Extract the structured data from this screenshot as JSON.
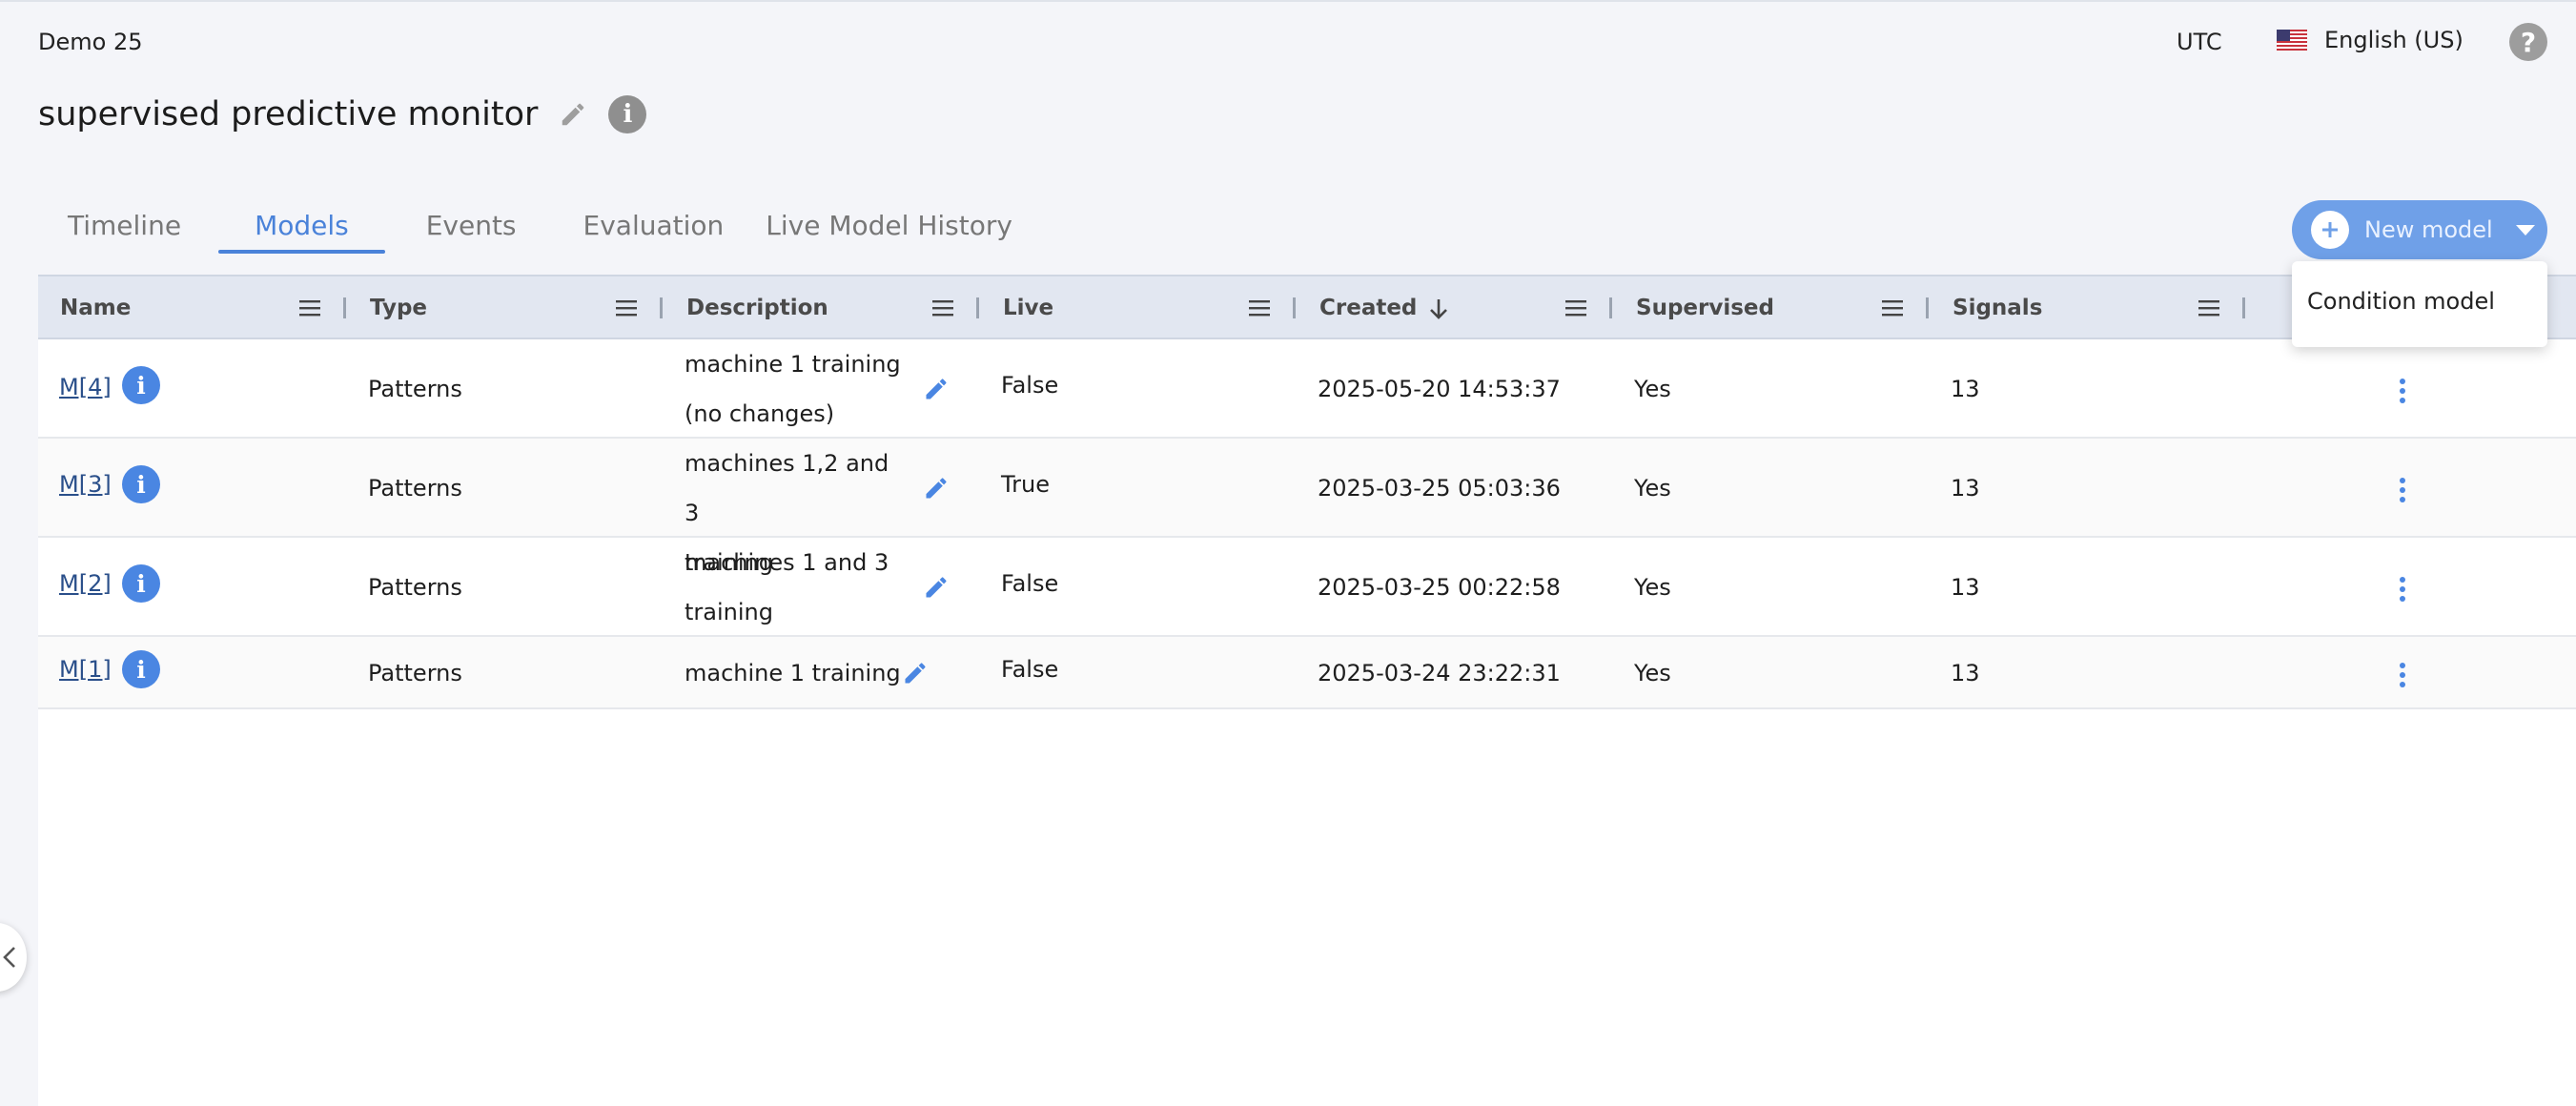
{
  "header": {
    "org": "Demo 25",
    "timezone": "UTC",
    "language": "English (US)",
    "help_icon": "question-circle-icon"
  },
  "page": {
    "title": "supervised predictive monitor"
  },
  "tabs": [
    {
      "label": "Timeline",
      "active": false
    },
    {
      "label": "Models",
      "active": true
    },
    {
      "label": "Events",
      "active": false
    },
    {
      "label": "Evaluation",
      "active": false
    },
    {
      "label": "Live Model History",
      "active": false
    }
  ],
  "new_model": {
    "label": "New model",
    "menu_items": [
      "Condition model"
    ]
  },
  "table": {
    "columns": [
      "Name",
      "Type",
      "Description",
      "Live",
      "Created",
      "Supervised",
      "Signals"
    ],
    "sort": {
      "column": "Created",
      "direction": "desc"
    },
    "rows": [
      {
        "name": "M[4]",
        "type": "Patterns",
        "description_lines": [
          "machine 1 training",
          "(no changes)"
        ],
        "live": "False",
        "created": "2025-05-20 14:53:37",
        "supervised": "Yes",
        "signals": "13"
      },
      {
        "name": "M[3]",
        "type": "Patterns",
        "description_lines": [
          "machines 1,2 and 3",
          "training"
        ],
        "live": "True",
        "created": "2025-03-25 05:03:36",
        "supervised": "Yes",
        "signals": "13"
      },
      {
        "name": "M[2]",
        "type": "Patterns",
        "description_lines": [
          "machines 1 and 3",
          "training"
        ],
        "live": "False",
        "created": "2025-03-25 00:22:58",
        "supervised": "Yes",
        "signals": "13"
      },
      {
        "name": "M[1]",
        "type": "Patterns",
        "description_lines": [
          "machine 1 training"
        ],
        "live": "False",
        "created": "2025-03-24 23:22:31",
        "supervised": "Yes",
        "signals": "13"
      }
    ]
  },
  "colors": {
    "accent": "#4a82d9",
    "button": "#6fa0e8",
    "header_bg": "#e2e7f1",
    "page_bg": "#f4f5f9"
  }
}
